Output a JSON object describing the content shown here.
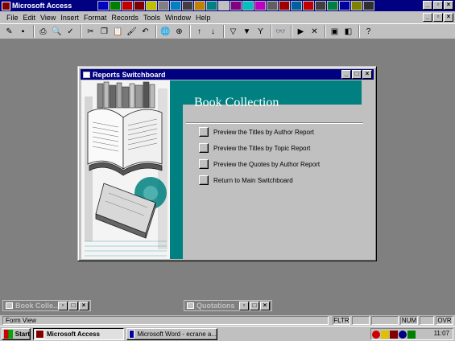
{
  "app": {
    "title": "Microsoft Access",
    "office_bar_icons": [
      "word-icon",
      "excel-icon",
      "powerpoint-icon",
      "access-icon",
      "outlook-icon",
      "binder-icon",
      "internet-icon",
      "find-icon",
      "explorer-icon",
      "mail-icon",
      "calendar-icon",
      "network-icon",
      "paint-icon",
      "help-icon",
      "settings-icon",
      "media-icon",
      "globe-icon",
      "acrobat-icon",
      "camera-icon",
      "mic-icon",
      "info-icon",
      "cd-icon",
      "close-icon"
    ]
  },
  "menu": {
    "items": [
      "File",
      "Edit",
      "View",
      "Insert",
      "Format",
      "Records",
      "Tools",
      "Window",
      "Help"
    ]
  },
  "toolbar": {
    "buttons": [
      {
        "name": "design-view-icon",
        "glyph": "✎"
      },
      {
        "name": "save-icon",
        "glyph": "▪"
      },
      {
        "name": "print-icon",
        "glyph": "⎙"
      },
      {
        "name": "print-preview-icon",
        "glyph": "🔍"
      },
      {
        "name": "spelling-icon",
        "glyph": "✓"
      },
      {
        "name": "cut-icon",
        "glyph": "✂"
      },
      {
        "name": "copy-icon",
        "glyph": "❐"
      },
      {
        "name": "paste-icon",
        "glyph": "📋"
      },
      {
        "name": "format-painter-icon",
        "glyph": "🖌"
      },
      {
        "name": "undo-icon",
        "glyph": "↶"
      },
      {
        "name": "insert-hyperlink-icon",
        "glyph": "🌐"
      },
      {
        "name": "web-toolbar-icon",
        "glyph": "⊕"
      },
      {
        "name": "sort-ascending-icon",
        "glyph": "↑"
      },
      {
        "name": "sort-descending-icon",
        "glyph": "↓"
      },
      {
        "name": "filter-by-selection-icon",
        "glyph": "▽"
      },
      {
        "name": "filter-by-form-icon",
        "glyph": "▼"
      },
      {
        "name": "apply-filter-icon",
        "glyph": "Y"
      },
      {
        "name": "find-icon",
        "glyph": "👓"
      },
      {
        "name": "new-record-icon",
        "glyph": "▶"
      },
      {
        "name": "delete-record-icon",
        "glyph": "✕"
      },
      {
        "name": "database-window-icon",
        "glyph": "▣"
      },
      {
        "name": "new-object-icon",
        "glyph": "◧"
      },
      {
        "name": "office-assistant-icon",
        "glyph": "?"
      }
    ]
  },
  "switchboard": {
    "title": "Reports Switchboard",
    "heading": "Book Collection",
    "options": [
      {
        "label": "Preview the Titles by Author Report"
      },
      {
        "label": "Preview the Titles by Topic Report"
      },
      {
        "label": "Preview the Quotes by Author Report"
      },
      {
        "label": "Return to Main Switchboard"
      }
    ]
  },
  "minimized": [
    {
      "title": "Book Colle..."
    },
    {
      "title": "Quotations"
    }
  ],
  "statusbar": {
    "text": "Form View",
    "indicators": [
      "FLTR",
      "",
      "",
      "NUM",
      "",
      "OVR"
    ]
  },
  "taskbar": {
    "start": "Start",
    "tasks": [
      "Microsoft Access",
      "Microsoft Word - ecrane a..."
    ],
    "clock": "11:07"
  },
  "colors": {
    "desktop": "#808080",
    "titlebar": "#000080",
    "accent_teal": "#008080",
    "face": "#c0c0c0"
  }
}
